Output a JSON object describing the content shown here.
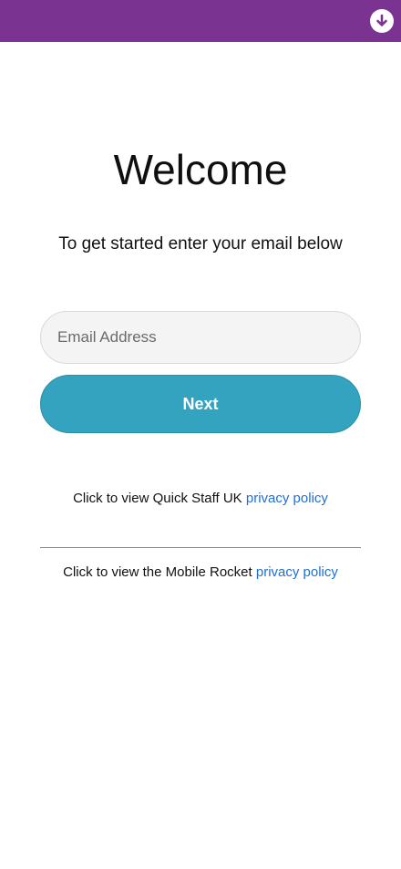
{
  "header": {
    "download_icon": "arrow-down-circle-icon",
    "bar_color": "#7a3391"
  },
  "main": {
    "title": "Welcome",
    "subtitle": "To get started enter your email below",
    "email": {
      "placeholder": "Email Address",
      "value": ""
    },
    "next_label": "Next",
    "accent_color": "#33a3bf"
  },
  "policies": [
    {
      "prefix": "Click to view Quick Staff UK",
      "link": "privacy policy"
    },
    {
      "prefix": "Click to view the Mobile Rocket",
      "link": "privacy policy"
    }
  ]
}
